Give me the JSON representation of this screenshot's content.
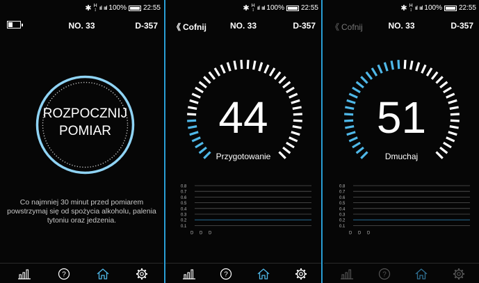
{
  "status": {
    "time": "22:55",
    "battery": "100%",
    "bluetooth": "✱",
    "h_top": "H",
    "h_bottom": "↕",
    "signal1": "ııl",
    "signal2": "ıııl"
  },
  "colors": {
    "accent": "#4fb8e8",
    "border": "#2a9fd6",
    "dim": "#555555",
    "text": "#ffffff"
  },
  "panels": [
    {
      "header": {
        "left_icon": "battery-icon",
        "number": "NO. 33",
        "device": "D-357"
      },
      "start_button": {
        "line1": "ROZPOCZNIJ",
        "line2": "POMIAR"
      },
      "notice": [
        "Co najmniej 30 minut przed pomiarem",
        "powstrzymaj się od spożycia alkoholu, palenia",
        "tytoniu oraz jedzenia."
      ],
      "nav": {
        "active": "home"
      }
    },
    {
      "header": {
        "back_label": "Cofnij",
        "number": "NO. 33",
        "device": "D-357"
      },
      "gauge": {
        "value": "44",
        "status": "Przygotowanie",
        "progress": 0.17
      },
      "chart": {
        "y_ticks": [
          "0.8",
          "0.7",
          "0.6",
          "0.5",
          "0.4",
          "0.3",
          "0.2",
          "0.1"
        ],
        "x_marks": [
          "D",
          "D",
          "D"
        ]
      },
      "nav": {
        "active": "home"
      }
    },
    {
      "header": {
        "back_label": "Cofnij",
        "number": "NO. 33",
        "device": "D-357"
      },
      "gauge": {
        "value": "51",
        "status": "Dmuchaj",
        "progress": 0.5
      },
      "chart": {
        "y_ticks": [
          "0.8",
          "0.7",
          "0.6",
          "0.5",
          "0.4",
          "0.3",
          "0.2",
          "0.1"
        ],
        "x_marks": [
          "D",
          "D",
          "D"
        ]
      },
      "nav": {
        "active": "home"
      }
    }
  ],
  "nav_items": [
    {
      "name": "statistics-icon"
    },
    {
      "name": "help-icon",
      "glyph": "?"
    },
    {
      "name": "home-icon"
    },
    {
      "name": "settings-icon"
    }
  ]
}
